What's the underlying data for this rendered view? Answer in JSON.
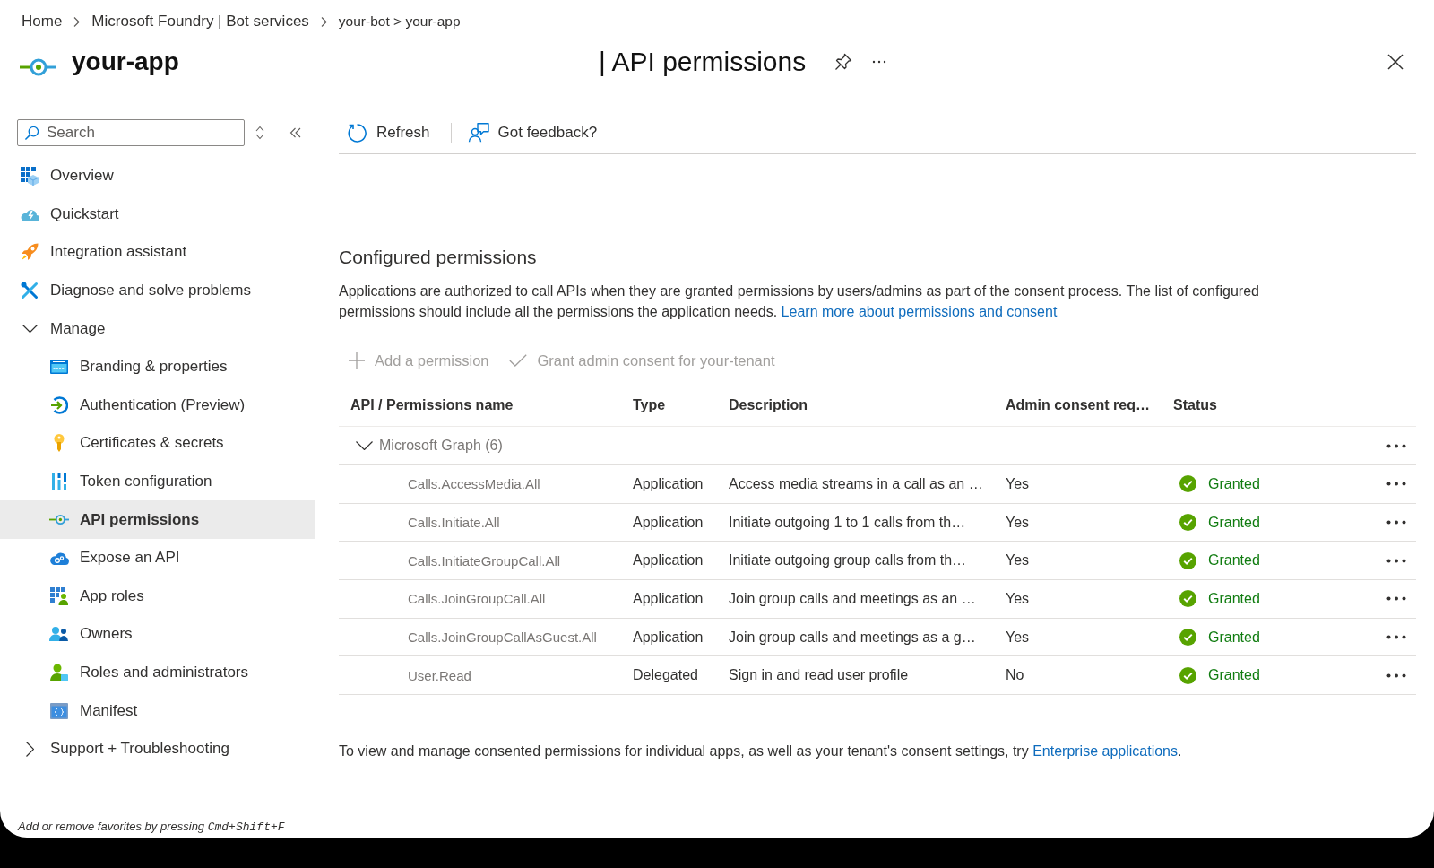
{
  "breadcrumb": [
    {
      "label": "Home"
    },
    {
      "label": "Microsoft Foundry | Bot services"
    },
    {
      "label": "your-bot > your-app"
    }
  ],
  "header": {
    "title": "your-app",
    "subtitle": "| API permissions"
  },
  "sidebar": {
    "search": {
      "placeholder": "Search"
    },
    "items": [
      {
        "label": "Overview",
        "kind": "item",
        "selected": false
      },
      {
        "label": "Quickstart",
        "kind": "item",
        "selected": false
      },
      {
        "label": "Integration assistant",
        "kind": "item",
        "selected": false
      },
      {
        "label": "Diagnose and solve problems",
        "kind": "item",
        "selected": false
      },
      {
        "label": "Manage",
        "kind": "group",
        "expanded": true,
        "selected": false,
        "children": [
          {
            "label": "Branding & properties",
            "selected": false
          },
          {
            "label": "Authentication (Preview)",
            "selected": false
          },
          {
            "label": "Certificates & secrets",
            "selected": false
          },
          {
            "label": "Token configuration",
            "selected": false
          },
          {
            "label": "API permissions",
            "selected": true
          },
          {
            "label": "Expose an API",
            "selected": false
          },
          {
            "label": "App roles",
            "selected": false
          },
          {
            "label": "Owners",
            "selected": false
          },
          {
            "label": "Roles and administrators",
            "selected": false
          },
          {
            "label": "Manifest",
            "selected": false
          }
        ]
      },
      {
        "label": "Support + Troubleshooting",
        "kind": "group",
        "expanded": false,
        "selected": false
      }
    ],
    "hint": {
      "text": "Add or remove favorites by pressing",
      "shortcut": "Cmd+Shift+F"
    }
  },
  "toolbar": [
    {
      "label": "Refresh"
    },
    {
      "label": "Got feedback?"
    }
  ],
  "section": {
    "title": "Configured permissions",
    "description": {
      "text": "Applications are authorized to call APIs when they are granted permissions by users/admins as part of the consent process. The list of configured permissions should include all the permissions the application needs.",
      "link": "Learn more about permissions and consent"
    },
    "actions": [
      {
        "label": "Add a permission",
        "disabled": true
      },
      {
        "label": "Grant admin consent for your-tenant",
        "disabled": true
      }
    ]
  },
  "table": {
    "columns": [
      "API / Permissions name",
      "Type",
      "Description",
      "Admin consent req…",
      "Status"
    ],
    "groups": [
      {
        "label": "Microsoft Graph (6)",
        "expanded": true,
        "rows": [
          {
            "name": "Calls.AccessMedia.All",
            "type": "Application",
            "description": "Access media streams in a call as an …",
            "admin_consent": "Yes",
            "status": "Granted"
          },
          {
            "name": "Calls.Initiate.All",
            "type": "Application",
            "description": "Initiate outgoing 1 to 1 calls from th…",
            "admin_consent": "Yes",
            "status": "Granted"
          },
          {
            "name": "Calls.InitiateGroupCall.All",
            "type": "Application",
            "description": "Initiate outgoing group calls from th…",
            "admin_consent": "Yes",
            "status": "Granted"
          },
          {
            "name": "Calls.JoinGroupCall.All",
            "type": "Application",
            "description": "Join group calls and meetings as an …",
            "admin_consent": "Yes",
            "status": "Granted"
          },
          {
            "name": "Calls.JoinGroupCallAsGuest.All",
            "type": "Application",
            "description": "Join group calls and meetings as a g…",
            "admin_consent": "Yes",
            "status": "Granted"
          },
          {
            "name": "User.Read",
            "type": "Delegated",
            "description": "Sign in and read user profile",
            "admin_consent": "No",
            "status": "Granted"
          }
        ]
      }
    ]
  },
  "footer_note": {
    "text": "To view and manage consented permissions for individual apps, as well as your tenant's consent settings, try",
    "link": "Enterprise applications",
    "end": "."
  }
}
